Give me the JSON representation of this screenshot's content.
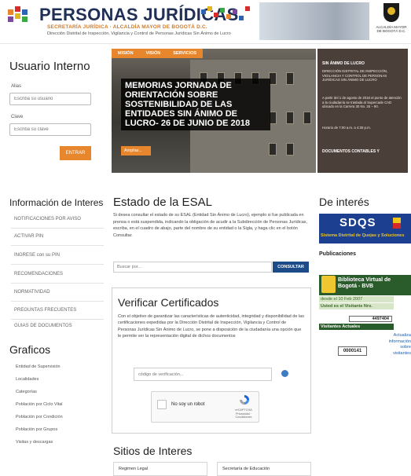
{
  "header": {
    "title": "PERSONAS JURÍDICAS",
    "subtitle": "SECRETARÍA JURÍDICA · ALCALDÍA MAYOR DE BOGOTÁ D.C.",
    "subtitle2": "Dirección Distrital de Inspección, Vigilancia y Control de Personas Jurídicas Sin Ánimo de Lucro",
    "crest_caption": "ALCALDÍA MAYOR DE BOGOTÁ D.C.",
    "logo_icon": "colored-squares-logo-icon",
    "crest_icon": "bogota-crest-icon"
  },
  "login": {
    "title": "Usuario Interno",
    "alias_label": "Alias",
    "alias_placeholder": "Escriba su usuario",
    "clave_label": "Clave",
    "clave_placeholder": "Escriba su clave",
    "submit": "ENTRAR"
  },
  "hero": {
    "tabs": [
      "MISIÓN",
      "VISIÓN",
      "SERVICIOS"
    ],
    "caption": "MEMORIAS JORNADA DE ORIENTACIÓN SOBRE SOSTENIBILIDAD DE LAS ENTIDADES SIN ÁNIMO DE LUCRO- 26 DE JUNIO DE 2018",
    "more": "Ampliar..."
  },
  "notice": {
    "title": "SIN ÁNIMO DE LUCRO",
    "p1": "DIRECCIÓN DISTRITAL DE INSPECCIÓN, VIGILANCIA Y CONTROL DE PERSONAS JURÍDICAS SIN ÁNIMO DE LUCRO",
    "p2": "A partir del 1 de agosto de 2018 el punto de atención a la ciudadanía se traslada al Supercade CAD ubicado en la Carrera 30 No. 25 – 90.",
    "p3": "Horario de 7:00 a.m. a 4:30 p.m.",
    "docs": "DOCUMENTOS CONTABLES Y"
  },
  "info": {
    "title": "Información de Interes",
    "items": [
      "NOTIFICACIONES POR AVISO",
      "ACTIVAR PIN",
      "INGRESE con su PIN",
      "RECOMENDACIONES",
      "NORMATIVIDAD",
      "PREGUNTAS FRECUENTES",
      "GUIAS DE DOCUMENTOS"
    ]
  },
  "graficos": {
    "title": "Graficos",
    "items": [
      "Entidad de Supervisión",
      "Localidades",
      "Categorías",
      "Población por Ciclo Vital",
      "Población por Condición",
      "Población por Grupos",
      "Visitas y descargas"
    ]
  },
  "estado": {
    "title": "Estado de la ESAL",
    "text": "Si desea consultar el estado de su ESAL (Entidad Sin Ánimo de Lucro), ejemplo si fue publicada en prensa o está suspendida, indicando la obligación de acudir a la Subdirección de Personas Jurídicas, escriba, en el cuadro de abajo, parte del nombre de su entidad o la Sigla, y haga clic en el botón Consultar.",
    "search_placeholder": "Buscar por...",
    "button": "CONSULTAR"
  },
  "verificar": {
    "title": "Verificar Certificados",
    "text": "Con el objetivo de garantizar las características de autenticidad, integridad y disponibilidad de las certificaciones expedidas por la Dirección Distrital de Inspección, Vigilancia y Control de Personas Jurídicas Sin Ánimo de Lucro, se pone a disposición de la ciudadanía una opción que le permite ver la representación digital de dichos documentos",
    "code_placeholder": "código de verificación...",
    "captcha_label": "No soy un robot",
    "captcha_brand": "reCAPTCHA",
    "captcha_terms": "Privacidad · Condiciones"
  },
  "sitios": {
    "title": "Sitios de Interes",
    "items": [
      "Regimen Legal",
      "Secretaría de Educación"
    ]
  },
  "deinteres": {
    "title": "De interés",
    "sdqs": "SDQS",
    "sdqs_sub": "Sistema Distrital de Quejas y Soluciones",
    "publicaciones": "Publicaciones",
    "bvb_title": "Biblioteca Virtual de Bogotá - BVB",
    "desde": "desde el 10 Feb 2007",
    "visitante_label": "Usted es el Visitante Nro.",
    "visitante_num": "4497404",
    "actuales_label": "Visitantes Actuales",
    "actuales_num": "0000141",
    "actualiza": "Actualiza información sobre visitantes"
  },
  "colors": {
    "accent": "#e8862d",
    "navy": "#1f2f55",
    "link": "#1a62b5",
    "sdqs_blue": "#1d3f8f",
    "bvb_green": "#2a5c2b"
  }
}
